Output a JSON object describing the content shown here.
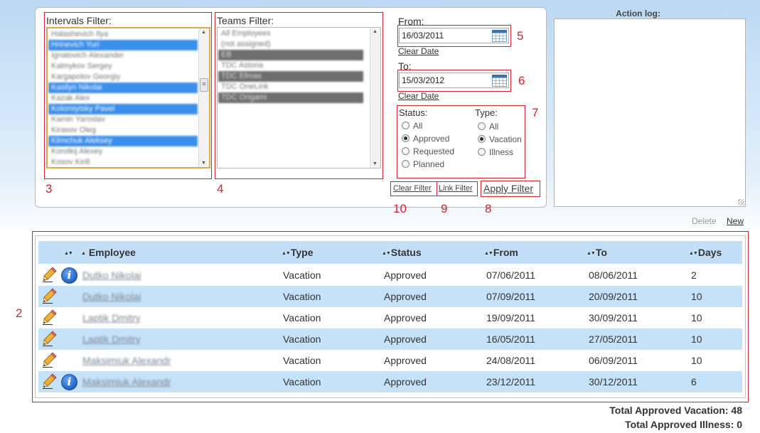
{
  "filters": {
    "intervals_label": "Intervals Filter:",
    "teams_label": "Teams Filter:",
    "intervals_items": [
      {
        "text": "Halashevich Ilya",
        "selected": false
      },
      {
        "text": "Hrinevich Yuri",
        "selected": true
      },
      {
        "text": "Ignatovich Alexander",
        "selected": false
      },
      {
        "text": "Kalmykov Sergey",
        "selected": false
      },
      {
        "text": "Kargapolov Georgiy",
        "selected": false
      },
      {
        "text": "Kasilyn Nikolai",
        "selected": true
      },
      {
        "text": "Kazak Alex",
        "selected": false
      },
      {
        "text": "Kolomiytsky Pavel",
        "selected": true
      },
      {
        "text": "Kamin Yaroslav",
        "selected": false
      },
      {
        "text": "Kirasov Oleg",
        "selected": false
      },
      {
        "text": "Klimchuk Aleksey",
        "selected": true
      },
      {
        "text": "Korotkij Alexey",
        "selected": false
      },
      {
        "text": "Kosov Kirill",
        "selected": false
      }
    ],
    "teams_items": [
      {
        "text": "All Employees",
        "selected": false
      },
      {
        "text": "(not assigned)",
        "selected": false
      },
      {
        "text": "EB",
        "selected": true
      },
      {
        "text": "TDC Astoria",
        "selected": false
      },
      {
        "text": "TDC Efmas",
        "selected": true
      },
      {
        "text": "TDC OneLink",
        "selected": false
      },
      {
        "text": "TDC Origami",
        "selected": true
      }
    ],
    "from_label": "From:",
    "from_value": "16/03/2011",
    "to_label": "To:",
    "to_value": "15/03/2012",
    "clear_date": "Clear Date",
    "status_label": "Status:",
    "status_options": [
      "All",
      "Approved",
      "Requested",
      "Planned"
    ],
    "status_selected": "Approved",
    "type_label": "Type:",
    "type_options": [
      "All",
      "Vacation",
      "Illness"
    ],
    "type_selected": "Vacation",
    "clear_filter": "Clear Filter",
    "link_filter": "Link Filter",
    "apply_filter": "Apply Filter"
  },
  "annotations": {
    "a2": "2",
    "a3": "3",
    "a4": "4",
    "a5": "5",
    "a6": "6",
    "a7": "7",
    "a8": "8",
    "a9": "9",
    "a10": "10"
  },
  "action_log": {
    "title": "Action log:",
    "delete": "Delete",
    "new": "New"
  },
  "table": {
    "columns": [
      "Employee",
      "Type",
      "Status",
      "From",
      "To",
      "Days"
    ],
    "rows": [
      {
        "employee": "Dutko Nikolai",
        "type": "Vacation",
        "status": "Approved",
        "from": "07/06/2011",
        "to": "08/06/2011",
        "days": "2",
        "info": true
      },
      {
        "employee": "Dutko Nikolai",
        "type": "Vacation",
        "status": "Approved",
        "from": "07/09/2011",
        "to": "20/09/2011",
        "days": "10",
        "info": false
      },
      {
        "employee": "Laptik Dmitry",
        "type": "Vacation",
        "status": "Approved",
        "from": "19/09/2011",
        "to": "30/09/2011",
        "days": "10",
        "info": false
      },
      {
        "employee": "Laptik Dmitry",
        "type": "Vacation",
        "status": "Approved",
        "from": "16/05/2011",
        "to": "27/05/2011",
        "days": "10",
        "info": false
      },
      {
        "employee": "Maksimiuk Alexandr",
        "type": "Vacation",
        "status": "Approved",
        "from": "24/08/2011",
        "to": "06/09/2011",
        "days": "10",
        "info": false
      },
      {
        "employee": "Maksimiuk Alexandr",
        "type": "Vacation",
        "status": "Approved",
        "from": "23/12/2011",
        "to": "30/12/2011",
        "days": "6",
        "info": true
      }
    ]
  },
  "totals": {
    "vacation": "Total Approved Vacation: 48",
    "illness": "Total Approved Illness: 0"
  },
  "colors": {
    "annotation_red": "#d6212f",
    "header_blue": "#c2dff7",
    "selected_blue": "#3b8eea"
  }
}
